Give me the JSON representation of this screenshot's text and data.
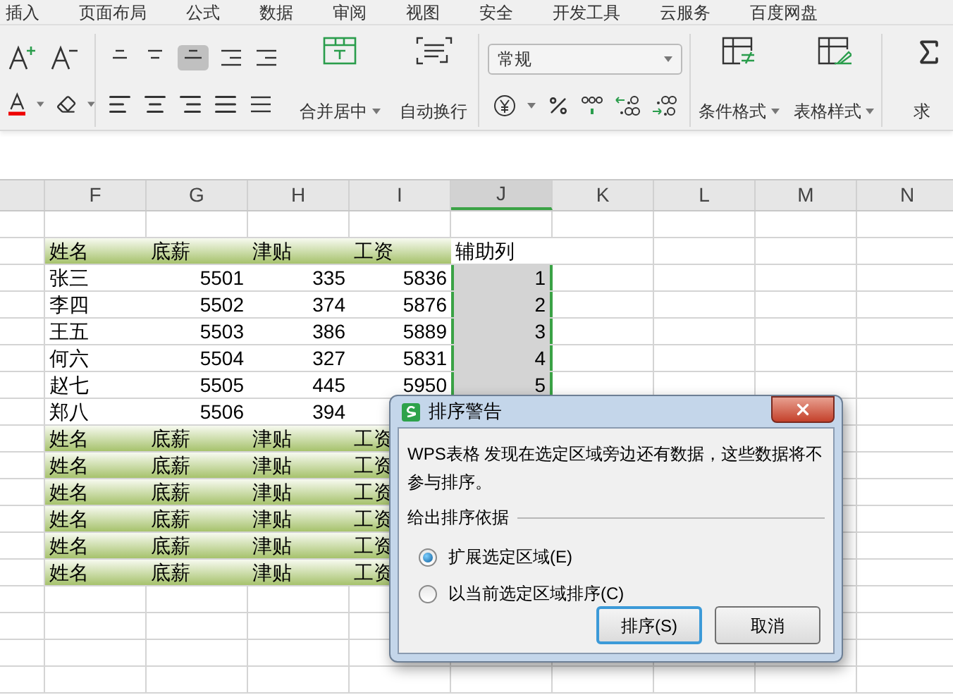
{
  "ribbon_tabs": [
    {
      "label": "插入"
    },
    {
      "label": "页面布局"
    },
    {
      "label": "公式"
    },
    {
      "label": "数据"
    },
    {
      "label": "审阅"
    },
    {
      "label": "视图"
    },
    {
      "label": "安全"
    },
    {
      "label": "开发工具"
    },
    {
      "label": "云服务"
    },
    {
      "label": "百度网盘"
    }
  ],
  "ribbon": {
    "merge_label": "合并居中",
    "wrap_label": "自动换行",
    "number_format": "常规",
    "conditional_label": "条件格式",
    "table_style_label": "表格样式",
    "sum_label": "求"
  },
  "columns": [
    "F",
    "G",
    "H",
    "I",
    "J",
    "K",
    "L",
    "M",
    "N"
  ],
  "sheet_rows": [
    {
      "kind": "blank",
      "cells": []
    },
    {
      "kind": "header",
      "cells": [
        "姓名",
        "底薪",
        "津贴",
        "工资",
        "辅助列"
      ]
    },
    {
      "kind": "data",
      "helper_selected": true,
      "cells": [
        "张三",
        "5501",
        "335",
        "5836",
        "1"
      ]
    },
    {
      "kind": "data",
      "helper_selected": true,
      "cells": [
        "李四",
        "5502",
        "374",
        "5876",
        "2"
      ]
    },
    {
      "kind": "data",
      "helper_selected": true,
      "cells": [
        "王五",
        "5503",
        "386",
        "5889",
        "3"
      ]
    },
    {
      "kind": "data",
      "helper_selected": true,
      "cells": [
        "何六",
        "5504",
        "327",
        "5831",
        "4"
      ]
    },
    {
      "kind": "data",
      "helper_selected": true,
      "cells": [
        "赵七",
        "5505",
        "445",
        "5950",
        "5"
      ]
    },
    {
      "kind": "data",
      "cells": [
        "郑八",
        "5506",
        "394"
      ]
    },
    {
      "kind": "header",
      "cells": [
        "姓名",
        "底薪",
        "津贴",
        "工资"
      ]
    },
    {
      "kind": "header",
      "cells": [
        "姓名",
        "底薪",
        "津贴",
        "工资"
      ]
    },
    {
      "kind": "header",
      "cells": [
        "姓名",
        "底薪",
        "津贴",
        "工资"
      ]
    },
    {
      "kind": "header",
      "cells": [
        "姓名",
        "底薪",
        "津贴",
        "工资"
      ]
    },
    {
      "kind": "header",
      "cells": [
        "姓名",
        "底薪",
        "津贴",
        "工资"
      ]
    },
    {
      "kind": "header",
      "cells": [
        "姓名",
        "底薪",
        "津贴",
        "工资"
      ]
    },
    {
      "kind": "blank",
      "cells": []
    },
    {
      "kind": "blank",
      "cells": []
    },
    {
      "kind": "blank",
      "cells": []
    },
    {
      "kind": "blank",
      "cells": []
    }
  ],
  "dialog": {
    "title": "排序警告",
    "message": "WPS表格 发现在选定区域旁边还有数据，这些数据将不参与排序。",
    "group_label": "给出排序依据",
    "options": [
      {
        "label": "扩展选定区域(E)",
        "selected": true
      },
      {
        "label": "以当前选定区域排序(C)",
        "selected": false
      }
    ],
    "buttons": [
      {
        "label": "排序(S)",
        "default": true
      },
      {
        "label": "取消",
        "default": false
      }
    ]
  }
}
